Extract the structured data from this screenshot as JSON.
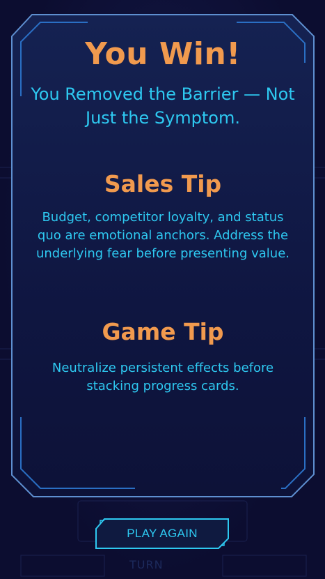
{
  "result": {
    "title": "You Win!",
    "subtitle": "You Removed the Barrier — Not Just the Symptom."
  },
  "sales_tip": {
    "heading": "Sales Tip",
    "body": "Budget, competitor loyalty, and status quo are emotional anchors. Address the underlying fear before presenting value."
  },
  "game_tip": {
    "heading": "Game Tip",
    "body": "Neutralize persistent effects before stacking progress cards."
  },
  "actions": {
    "play_again_label": "PLAY AGAIN"
  },
  "background": {
    "turn_label": "TURN"
  },
  "colors": {
    "background": "#0c0d30",
    "panel_fill": "#121a45",
    "panel_border": "#5e8fd0",
    "accent_orange": "#f19a4e",
    "accent_cyan": "#2ec9f1"
  }
}
